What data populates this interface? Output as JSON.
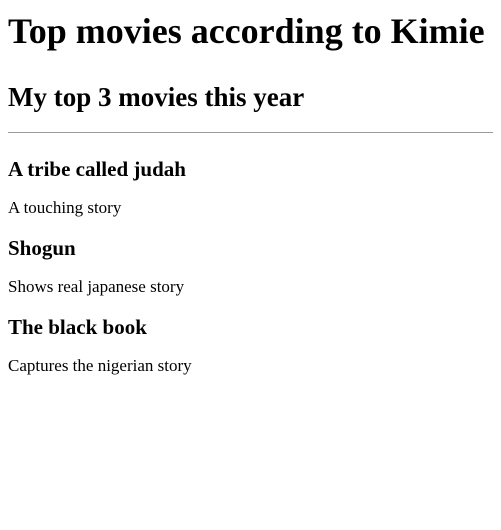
{
  "header": {
    "title": "Top movies according to Kimie",
    "subtitle": "My top 3 movies this year"
  },
  "movies": [
    {
      "title": "A tribe called judah",
      "description": "A touching story"
    },
    {
      "title": "Shogun",
      "description": "Shows real japanese story"
    },
    {
      "title": "The black book",
      "description": "Captures the nigerian story"
    }
  ]
}
